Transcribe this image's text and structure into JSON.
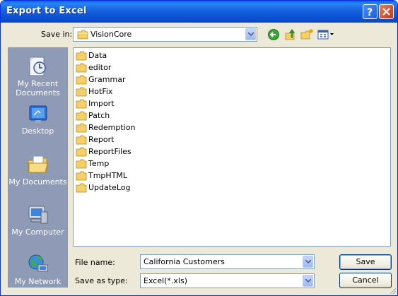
{
  "window": {
    "title": "Export to Excel"
  },
  "save_in": {
    "label": "Save in:",
    "value": "VisionCore"
  },
  "places": [
    {
      "label_line1": "My Recent",
      "label_line2": "Documents",
      "icon": "recent-documents-icon"
    },
    {
      "label_line1": "Desktop",
      "label_line2": "",
      "icon": "desktop-icon"
    },
    {
      "label_line1": "My Documents",
      "label_line2": "",
      "icon": "my-documents-icon"
    },
    {
      "label_line1": "My Computer",
      "label_line2": "",
      "icon": "my-computer-icon"
    },
    {
      "label_line1": "My Network",
      "label_line2": "",
      "icon": "my-network-icon"
    }
  ],
  "folders": [
    "Data",
    "editor",
    "Grammar",
    "HotFix",
    "Import",
    "Patch",
    "Redemption",
    "Report",
    "ReportFiles",
    "Temp",
    "TmpHTML",
    "UpdateLog"
  ],
  "file_name": {
    "label": "File name:",
    "value": "California Customers"
  },
  "save_as_type": {
    "label": "Save as type:",
    "value": "Excel(*.xls)"
  },
  "buttons": {
    "save": "Save",
    "cancel": "Cancel"
  },
  "toolbar_icons": [
    "back-icon",
    "up-folder-icon",
    "new-folder-icon",
    "views-menu-icon"
  ],
  "colors": {
    "title_bar": "#0b4fd2",
    "dialog_bg": "#ece9d8",
    "places_bar": "#8f9bb6",
    "folder": "#f5d06a"
  }
}
